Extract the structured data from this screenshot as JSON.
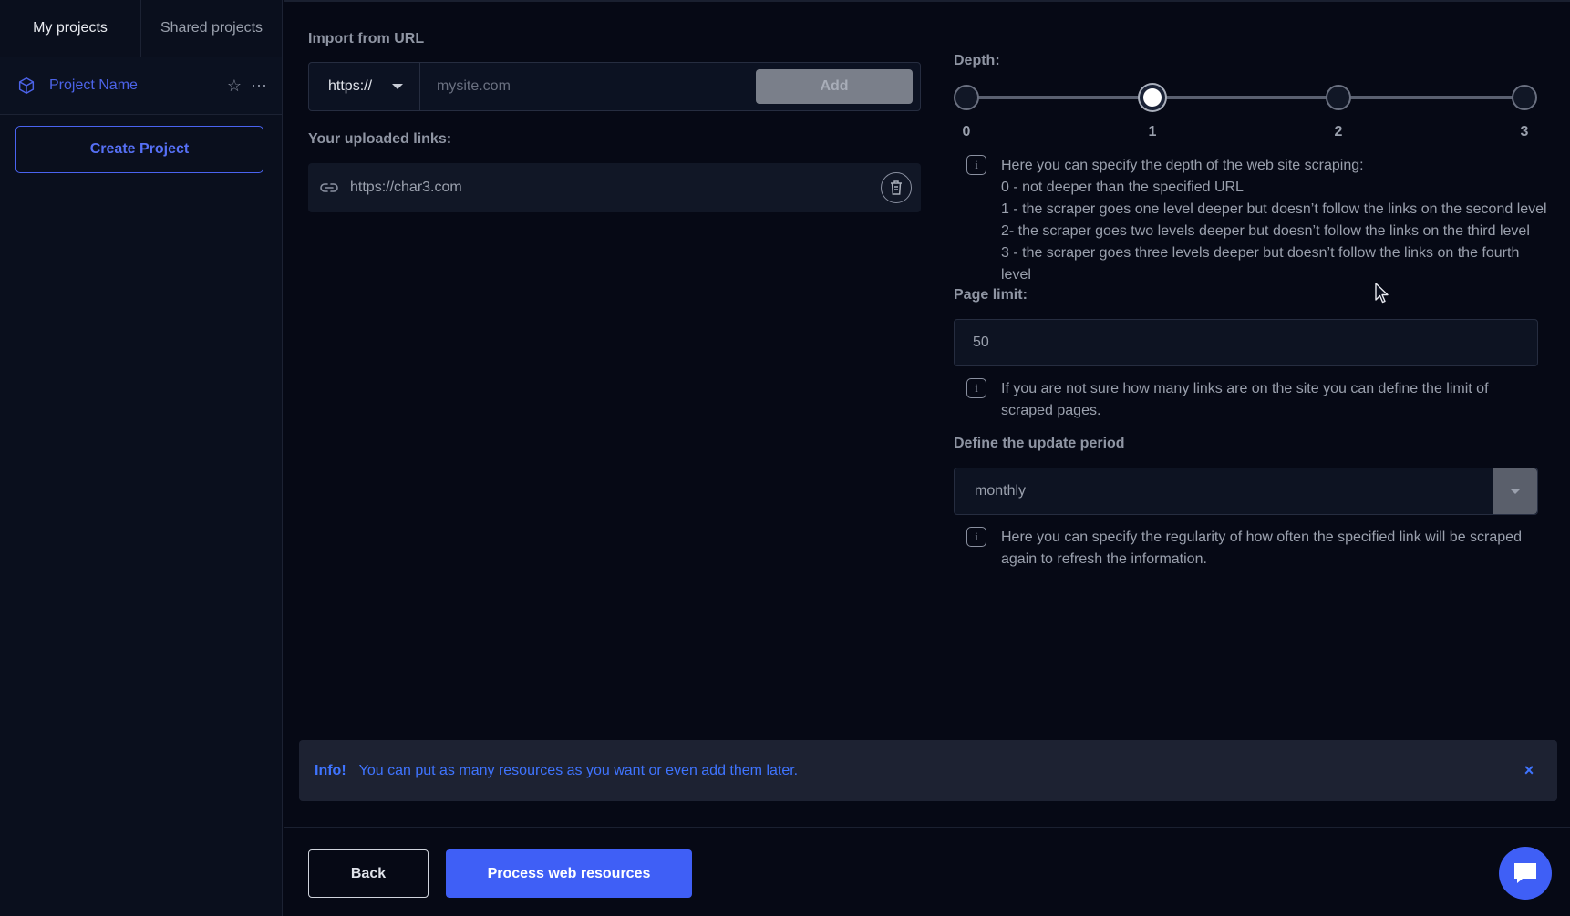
{
  "sidebar": {
    "tabs": [
      {
        "label": "My projects"
      },
      {
        "label": "Shared projects"
      }
    ],
    "project": {
      "name": "Project Name"
    },
    "create_label": "Create Project"
  },
  "import": {
    "title": "Import from URL",
    "protocol": "https://",
    "placeholder": "mysite.com",
    "add_label": "Add"
  },
  "uploaded": {
    "title": "Your uploaded links:",
    "links": [
      "https://char3.com"
    ]
  },
  "depth": {
    "title": "Depth:",
    "levels": [
      "0",
      "1",
      "2",
      "3"
    ],
    "selected": 1,
    "info": [
      "Here you can specify the depth of the web site scraping:",
      "0 - not deeper than the specified URL",
      "1 - the scraper goes one level deeper but doesn’t follow the links on the second level",
      "2- the scraper goes two levels deeper but doesn’t follow the links on the third level",
      "3 - the scraper goes three levels deeper but doesn’t follow the links on the fourth level"
    ]
  },
  "page_limit": {
    "title": "Page limit:",
    "value": "50",
    "info": "If you are not sure how many links are on the site you can define the limit of scraped pages."
  },
  "update_period": {
    "title": "Define the update period",
    "value": "monthly",
    "info": "Here you can specify the regularity of how often the specified link will be scraped again to refresh the information."
  },
  "alert": {
    "title": "Info!",
    "text": "You can put as many resources as you want or even add them later.",
    "close": "×"
  },
  "footer": {
    "back_label": "Back",
    "process_label": "Process web resources"
  },
  "colors": {
    "accent": "#3f5ff6",
    "background": "#060915",
    "link": "#4c63e8"
  }
}
